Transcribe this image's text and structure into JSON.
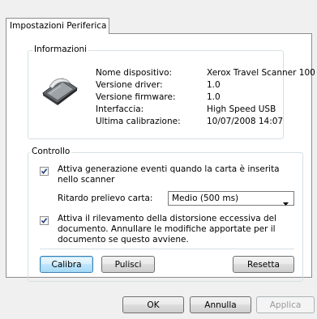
{
  "tab": {
    "label": "Impostazioni Periferica"
  },
  "info": {
    "title": "Informazioni",
    "rows": [
      {
        "label": "Nome dispositivo:",
        "value": "Xerox Travel Scanner 100"
      },
      {
        "label": "Versione driver:",
        "value": "1.0"
      },
      {
        "label": "Versione firmware:",
        "value": "1.0"
      },
      {
        "label": "Interfaccia:",
        "value": "High Speed USB"
      },
      {
        "label": "Ultima calibrazione:",
        "value": "10/07/2008  14:07"
      }
    ]
  },
  "control": {
    "title": "Controllo",
    "event_checkbox": {
      "checked": true,
      "text": "Attiva generazione eventi quando la carta è inserita nello scanner"
    },
    "delay": {
      "label": "Ritardo prelievo carta:",
      "value": "Medio (500 ms)"
    },
    "distortion_checkbox": {
      "checked": true,
      "text": "Attiva il rilevamento della distorsione eccessiva del documento. Annullare le modifiche apportate per il documento se questo avviene."
    },
    "buttons": {
      "calibrate": "Calibra",
      "clean": "Pulisci",
      "reset": "Resetta"
    }
  },
  "footer": {
    "ok": "OK",
    "cancel": "Annulla",
    "apply": "Applica"
  }
}
